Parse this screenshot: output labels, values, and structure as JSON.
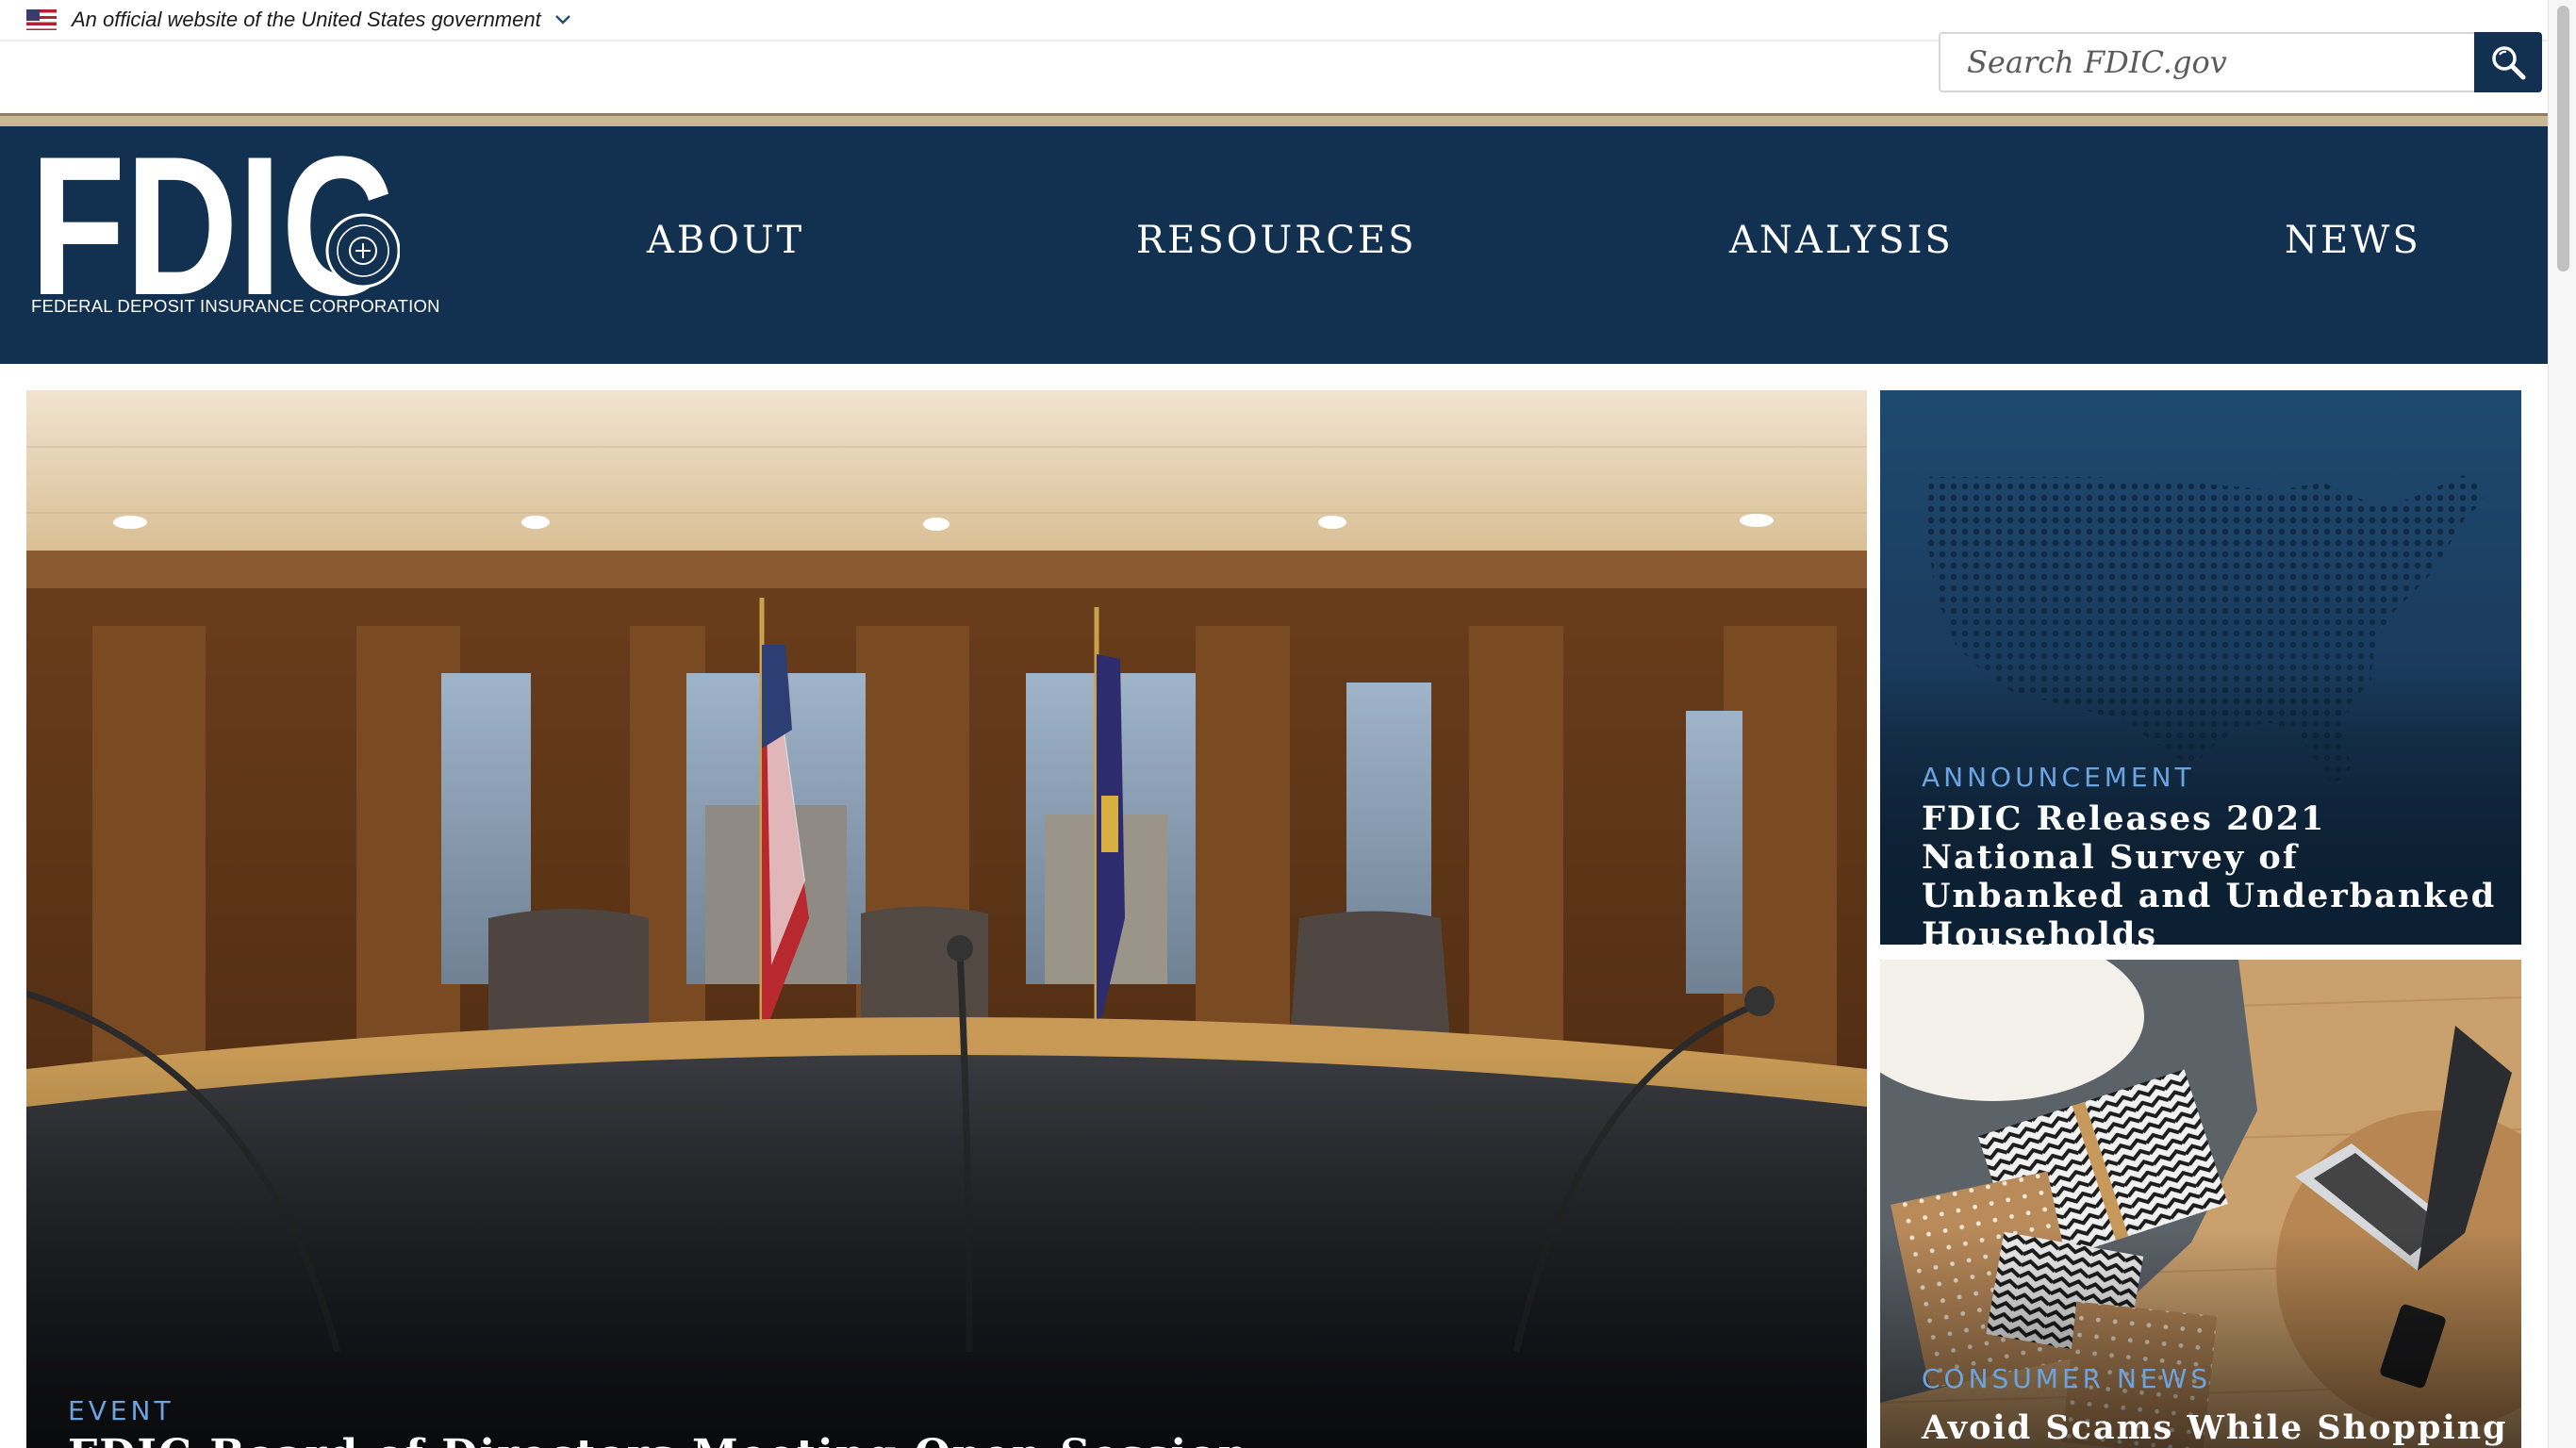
{
  "gov_banner": {
    "text": "An official website of the United States government",
    "flag_icon": "us-flag-icon",
    "toggle_icon": "chevron-down-icon"
  },
  "search": {
    "placeholder": "Search FDIC.gov",
    "button_icon": "search-icon"
  },
  "header": {
    "logo_text": "FDIC",
    "logo_subtitle": "FEDERAL DEPOSIT INSURANCE CORPORATION",
    "nav": [
      {
        "label": "ABOUT"
      },
      {
        "label": "RESOURCES"
      },
      {
        "label": "ANALYSIS"
      },
      {
        "label": "NEWS"
      }
    ]
  },
  "hero": {
    "tag": "EVENT",
    "headline": "FDIC Board of Directors Meeting Open Session"
  },
  "cards": [
    {
      "tag": "ANNOUNCEMENT",
      "headline": "FDIC Releases 2021 National Survey of Unbanked and Underbanked Households"
    },
    {
      "tag": "CONSUMER NEWS",
      "headline": "Avoid Scams While Shopping"
    }
  ],
  "colors": {
    "navy": "#12304f",
    "gold": "#c7b991",
    "tag_blue": "#6ba4e0"
  }
}
